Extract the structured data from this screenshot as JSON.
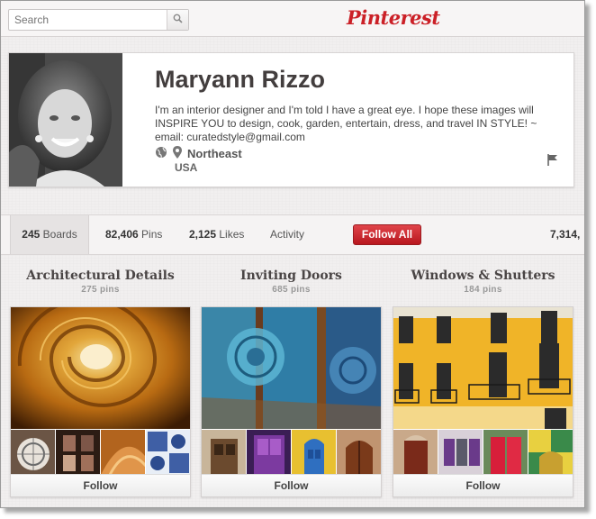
{
  "header": {
    "search_placeholder": "Search",
    "logo_text": "Pinterest",
    "brand_color": "#cb2027",
    "search_icon": "search-icon"
  },
  "profile": {
    "name": "Maryann Rizzo",
    "bio": "I'm an interior designer and I'm told I have a great eye. I hope these images will INSPIRE YOU to design, cook, garden, entertain, dress, and travel IN STYLE! ~ email: curatedstyle@gmail.com",
    "location_line1": "Northeast",
    "location_line2": "USA",
    "icons": [
      "globe-icon",
      "location-pin-icon",
      "flag-icon"
    ]
  },
  "stats": {
    "boards_count": "245",
    "boards_label": "Boards",
    "pins_count": "82,406",
    "pins_label": "Pins",
    "likes_count": "2,125",
    "likes_label": "Likes",
    "activity_label": "Activity",
    "follow_all_label": "Follow All",
    "followers_count": "7,314,"
  },
  "boards": [
    {
      "title": "Architectural Details",
      "count": "275 pins",
      "follow_label": "Follow"
    },
    {
      "title": "Inviting Doors",
      "count": "685 pins",
      "follow_label": "Follow"
    },
    {
      "title": "Windows & Shutters",
      "count": "184 pins",
      "follow_label": "Follow"
    }
  ]
}
